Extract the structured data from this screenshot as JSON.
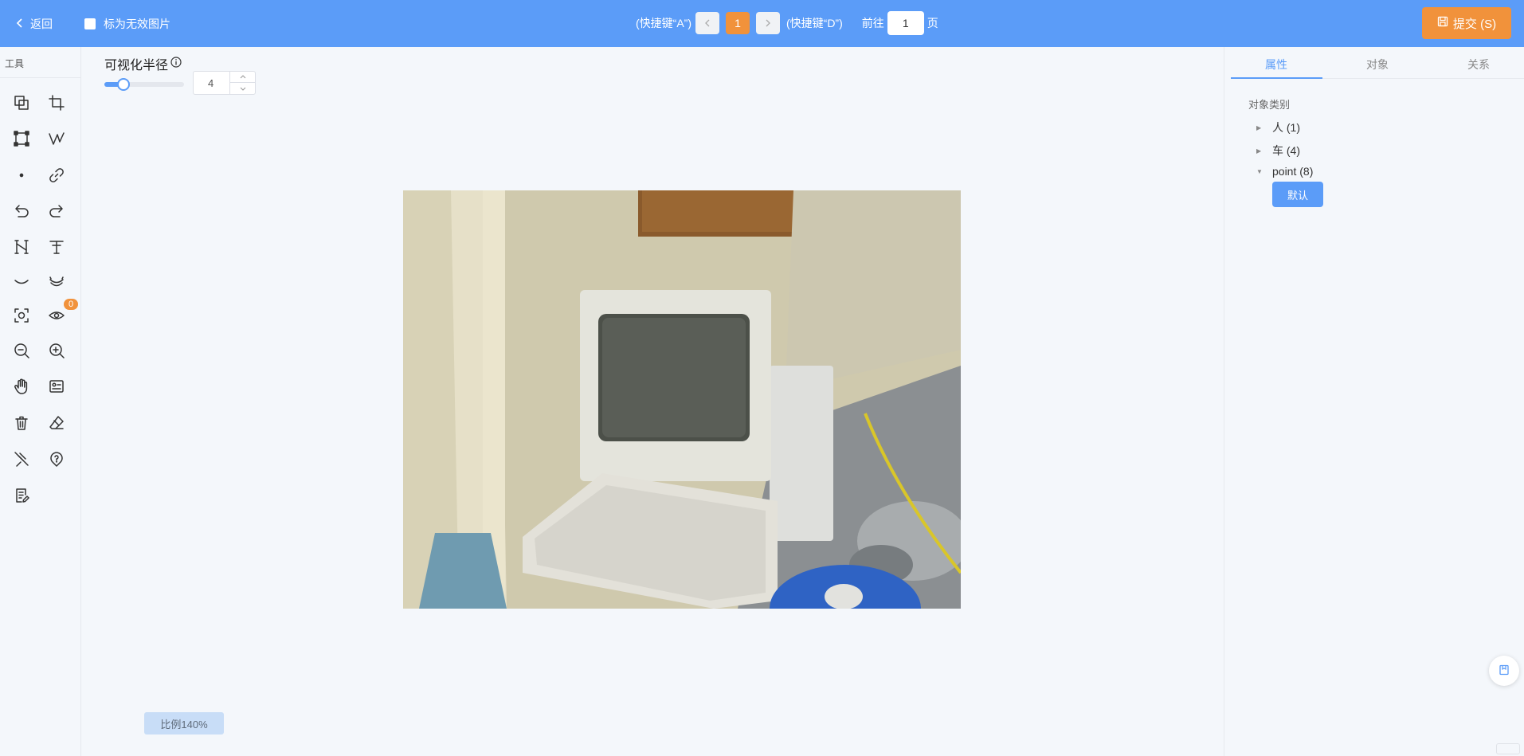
{
  "header": {
    "back_label": "返回",
    "invalid_label": "标为无效图片",
    "prev_hint": "(快捷键“A”)",
    "next_hint": "(快捷键“D”)",
    "current_page": "1",
    "goto_prefix": "前往",
    "goto_value": "1",
    "goto_suffix": "页",
    "submit_label": "提交 (S)"
  },
  "toolbar": {
    "title": "工具",
    "badge_count": "0"
  },
  "radius": {
    "label": "可视化半径",
    "value": "4",
    "level": 0.24
  },
  "canvas": {
    "scale_label": "比例140%"
  },
  "panel": {
    "tabs": [
      "属性",
      "对象",
      "关系"
    ],
    "active_tab": "属性",
    "category_title": "对象类别",
    "categories": [
      {
        "label": "人 (1)",
        "expanded": false
      },
      {
        "label": "车 (4)",
        "expanded": false
      },
      {
        "label": "point (8)",
        "expanded": true
      }
    ],
    "default_button": "默认"
  },
  "colors": {
    "primary": "#5b9cf8",
    "accent": "#f1923b"
  }
}
